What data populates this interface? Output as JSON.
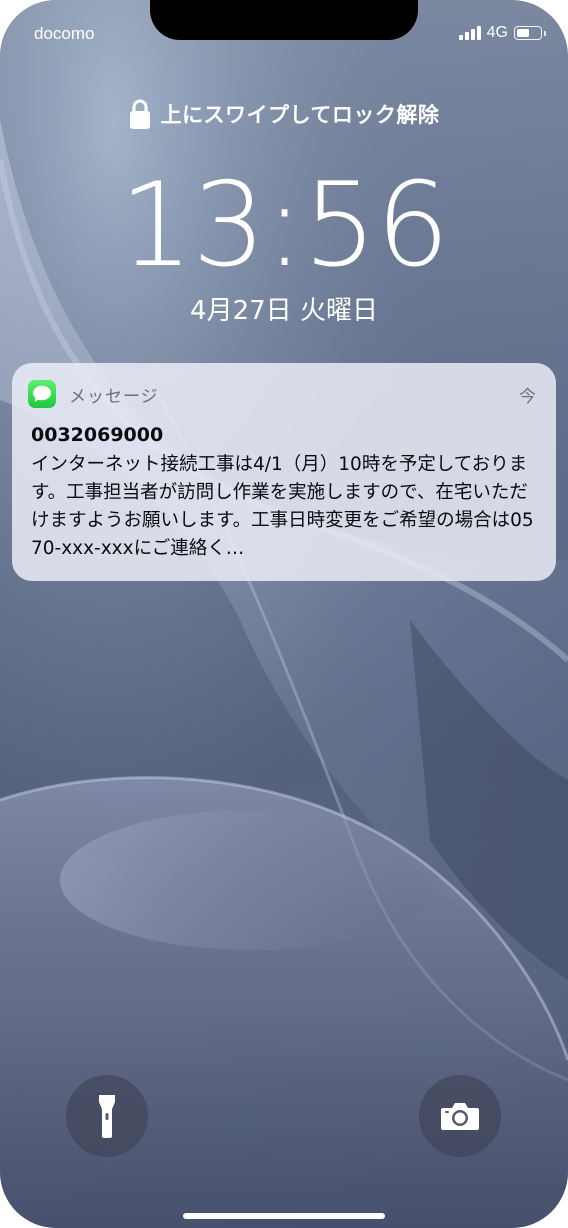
{
  "status_bar": {
    "carrier": "docomo",
    "network": "4G",
    "signal_icon": "cellular-signal-icon",
    "battery_icon": "battery-icon"
  },
  "lock_screen": {
    "unlock_hint": "上にスワイプしてロック解除",
    "time": "13:56",
    "date": "4月27日 火曜日"
  },
  "notification": {
    "app_icon": "messages-app-icon",
    "app_name": "メッセージ",
    "time": "今",
    "sender": "0032069000",
    "message": "インターネット接続工事は4/1（月）10時を予定しております。工事担当者が訪問し作業を実施しますので、在宅いただけますようお願いします。工事日時変更をご希望の場合は0570-xxx-xxxにご連絡く…",
    "background_color": "#ECEEF8"
  },
  "controls": {
    "flashlight_icon": "flashlight-icon",
    "camera_icon": "camera-icon"
  }
}
